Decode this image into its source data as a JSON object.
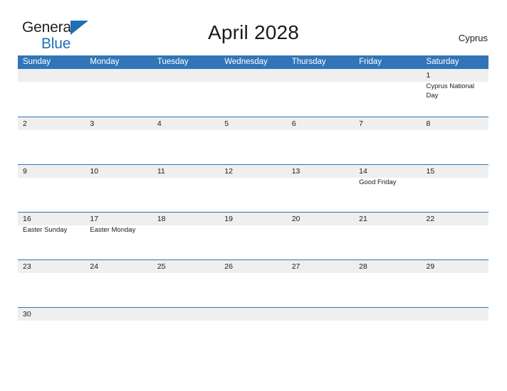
{
  "brand": {
    "name_part1": "General",
    "name_part2": "Blue",
    "triangle_icon": "triangle-icon",
    "accent_color": "#1F6FB5"
  },
  "header": {
    "title": "April 2028",
    "locale": "Cyprus"
  },
  "colors": {
    "header_blue": "#3175B8",
    "row_divider_blue": "#2E75B6",
    "daynum_band_gray": "#EFEFEF",
    "text": "#1a1a1a"
  },
  "calendar": {
    "month": "April",
    "year": "2028",
    "weekday_headers": [
      "Sunday",
      "Monday",
      "Tuesday",
      "Wednesday",
      "Thursday",
      "Friday",
      "Saturday"
    ],
    "weeks": [
      {
        "days": [
          {
            "date": "",
            "events": []
          },
          {
            "date": "",
            "events": []
          },
          {
            "date": "",
            "events": []
          },
          {
            "date": "",
            "events": []
          },
          {
            "date": "",
            "events": []
          },
          {
            "date": "",
            "events": []
          },
          {
            "date": "1",
            "events": [
              "Cyprus National Day"
            ]
          }
        ]
      },
      {
        "days": [
          {
            "date": "2",
            "events": []
          },
          {
            "date": "3",
            "events": []
          },
          {
            "date": "4",
            "events": []
          },
          {
            "date": "5",
            "events": []
          },
          {
            "date": "6",
            "events": []
          },
          {
            "date": "7",
            "events": []
          },
          {
            "date": "8",
            "events": []
          }
        ]
      },
      {
        "days": [
          {
            "date": "9",
            "events": []
          },
          {
            "date": "10",
            "events": []
          },
          {
            "date": "11",
            "events": []
          },
          {
            "date": "12",
            "events": []
          },
          {
            "date": "13",
            "events": []
          },
          {
            "date": "14",
            "events": [
              "Good Friday"
            ]
          },
          {
            "date": "15",
            "events": []
          }
        ]
      },
      {
        "days": [
          {
            "date": "16",
            "events": [
              "Easter Sunday"
            ]
          },
          {
            "date": "17",
            "events": [
              "Easter Monday"
            ]
          },
          {
            "date": "18",
            "events": []
          },
          {
            "date": "19",
            "events": []
          },
          {
            "date": "20",
            "events": []
          },
          {
            "date": "21",
            "events": []
          },
          {
            "date": "22",
            "events": []
          }
        ]
      },
      {
        "days": [
          {
            "date": "23",
            "events": []
          },
          {
            "date": "24",
            "events": []
          },
          {
            "date": "25",
            "events": []
          },
          {
            "date": "26",
            "events": []
          },
          {
            "date": "27",
            "events": []
          },
          {
            "date": "28",
            "events": []
          },
          {
            "date": "29",
            "events": []
          }
        ]
      },
      {
        "last": true,
        "days": [
          {
            "date": "30",
            "events": []
          },
          {
            "date": "",
            "events": []
          },
          {
            "date": "",
            "events": []
          },
          {
            "date": "",
            "events": []
          },
          {
            "date": "",
            "events": []
          },
          {
            "date": "",
            "events": []
          },
          {
            "date": "",
            "events": []
          }
        ]
      }
    ]
  }
}
